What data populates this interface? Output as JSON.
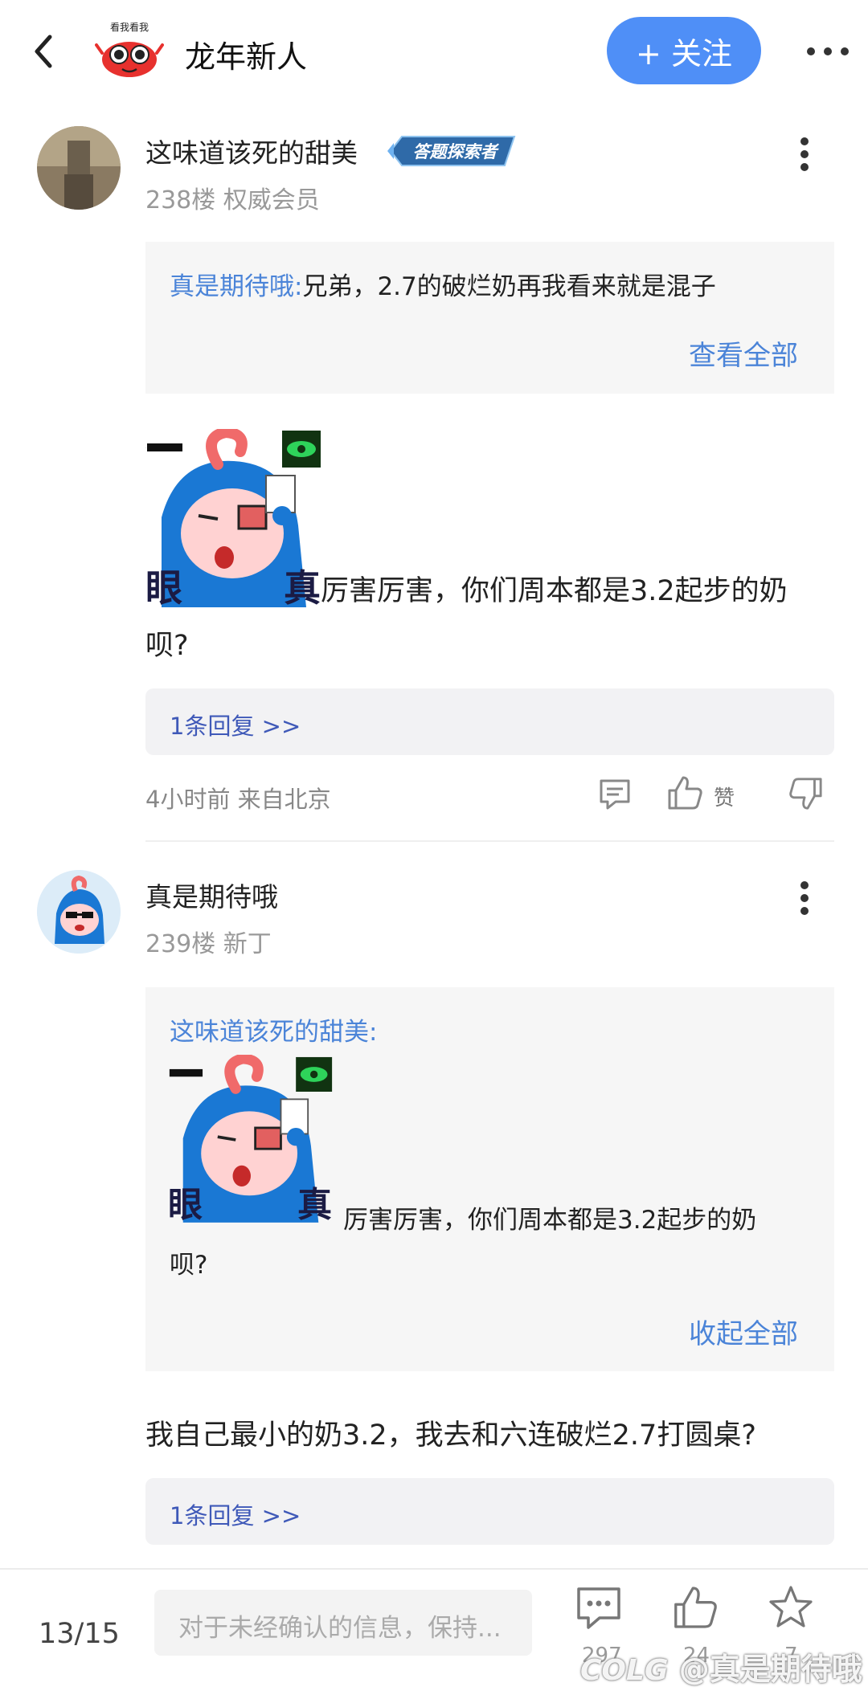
{
  "header": {
    "title": "龙年新人",
    "follow_label": "+ 关注",
    "logo_text": "看我看我"
  },
  "posts": [
    {
      "username": "这味道该死的甜美",
      "badge": "答题探索者",
      "floor_meta": "238楼 权威会员",
      "quote": {
        "author": "真是期待哦:",
        "text": "兄弟，2.7的破烂奶再我看来就是混子",
        "toggle": "查看全部"
      },
      "sticker_chars": [
        "一",
        "眼",
        "真"
      ],
      "text_line1": "厉害厉害，你们周本都是3.2起步的奶",
      "text_line2": "呗?",
      "reply_link": "1条回复 >>",
      "time_info": "4小时前 来自北京",
      "like_label": "赞"
    },
    {
      "username": "真是期待哦",
      "floor_meta": "239楼 新丁",
      "quote": {
        "author": "这味道该死的甜美:",
        "text_line1": "厉害厉害，你们周本都是3.2起步的奶",
        "text_line2": "呗?",
        "toggle": "收起全部"
      },
      "text": "我自己最小的奶3.2，我去和六连破烂2.7打圆桌?",
      "reply_link": "1条回复 >>"
    }
  ],
  "bottom_bar": {
    "page_indicator": "13/15",
    "input_placeholder": "对于未经确认的信息，保持...",
    "comment_count": "297",
    "like_count": "24",
    "star_count": "7"
  },
  "watermark": "@真是期待哦",
  "watermark_logo": "COLG",
  "colors": {
    "accent": "#4f8ff7",
    "link": "#4b84d8",
    "reply_link": "#3f59b8"
  }
}
